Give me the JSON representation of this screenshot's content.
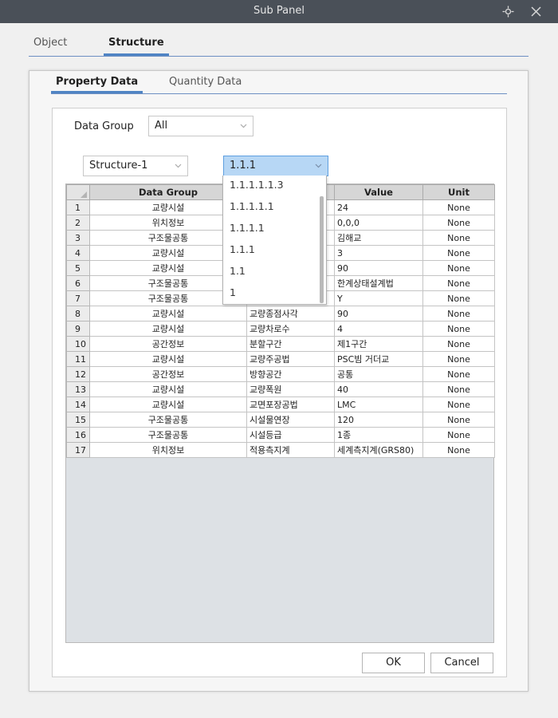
{
  "window": {
    "title": "Sub Panel",
    "icons": [
      "move-icon",
      "close-icon"
    ]
  },
  "outer_tabs": [
    {
      "label": "Object",
      "active": false
    },
    {
      "label": "Structure",
      "active": true
    }
  ],
  "inner_tabs": [
    {
      "label": "Property Data",
      "active": true
    },
    {
      "label": "Quantity Data",
      "active": false
    }
  ],
  "filters": {
    "data_group_label": "Data Group",
    "data_group_value": "All",
    "structure_value": "Structure-1",
    "level_value": "1.1.1"
  },
  "dropdown": {
    "options": [
      "1.1.1.1.1.3",
      "1.1.1.1.1",
      "1.1.1.1",
      "1.1.1",
      "1.1",
      "1"
    ]
  },
  "table": {
    "headers": [
      "",
      "Data Group",
      "",
      "Value",
      "Unit"
    ],
    "rows": [
      {
        "n": "1",
        "group": "교량시설",
        "item": "",
        "value": "24",
        "unit": "None"
      },
      {
        "n": "2",
        "group": "위치정보",
        "item": "",
        "value": "0,0,0",
        "unit": "None"
      },
      {
        "n": "3",
        "group": "구조물공통",
        "item": "",
        "value": "김해교",
        "unit": "None"
      },
      {
        "n": "4",
        "group": "교량시설",
        "item": "",
        "value": "3",
        "unit": "None"
      },
      {
        "n": "5",
        "group": "교량시설",
        "item": "",
        "value": "90",
        "unit": "None"
      },
      {
        "n": "6",
        "group": "구조물공통",
        "item": "",
        "value": "한계상태설계법",
        "unit": "None"
      },
      {
        "n": "7",
        "group": "구조물공통",
        "item": "",
        "value": "Y",
        "unit": "None"
      },
      {
        "n": "8",
        "group": "교량시설",
        "item": "교량종점사각",
        "value": "90",
        "unit": "None"
      },
      {
        "n": "9",
        "group": "교량시설",
        "item": "교량차로수",
        "value": "4",
        "unit": "None"
      },
      {
        "n": "10",
        "group": "공간정보",
        "item": "분할구간",
        "value": "제1구간",
        "unit": "None"
      },
      {
        "n": "11",
        "group": "교량시설",
        "item": "교량주공법",
        "value": "PSC빔 거더교",
        "unit": "None"
      },
      {
        "n": "12",
        "group": "공간정보",
        "item": "방향공간",
        "value": "공통",
        "unit": "None"
      },
      {
        "n": "13",
        "group": "교량시설",
        "item": "교량폭원",
        "value": "40",
        "unit": "None"
      },
      {
        "n": "14",
        "group": "교량시설",
        "item": "교면포장공법",
        "value": "LMC",
        "unit": "None"
      },
      {
        "n": "15",
        "group": "구조물공통",
        "item": "시설물연장",
        "value": "120",
        "unit": "None"
      },
      {
        "n": "16",
        "group": "구조물공통",
        "item": "시설등급",
        "value": "1종",
        "unit": "None"
      },
      {
        "n": "17",
        "group": "위치정보",
        "item": "적용측지계",
        "value": "세계측지계(GRS80)",
        "unit": "None"
      }
    ]
  },
  "buttons": {
    "ok": "OK",
    "cancel": "Cancel"
  },
  "colors": {
    "titlebar": "#4a5058",
    "accent": "#4f84c4",
    "selected_combo": "#b7d7f5"
  }
}
